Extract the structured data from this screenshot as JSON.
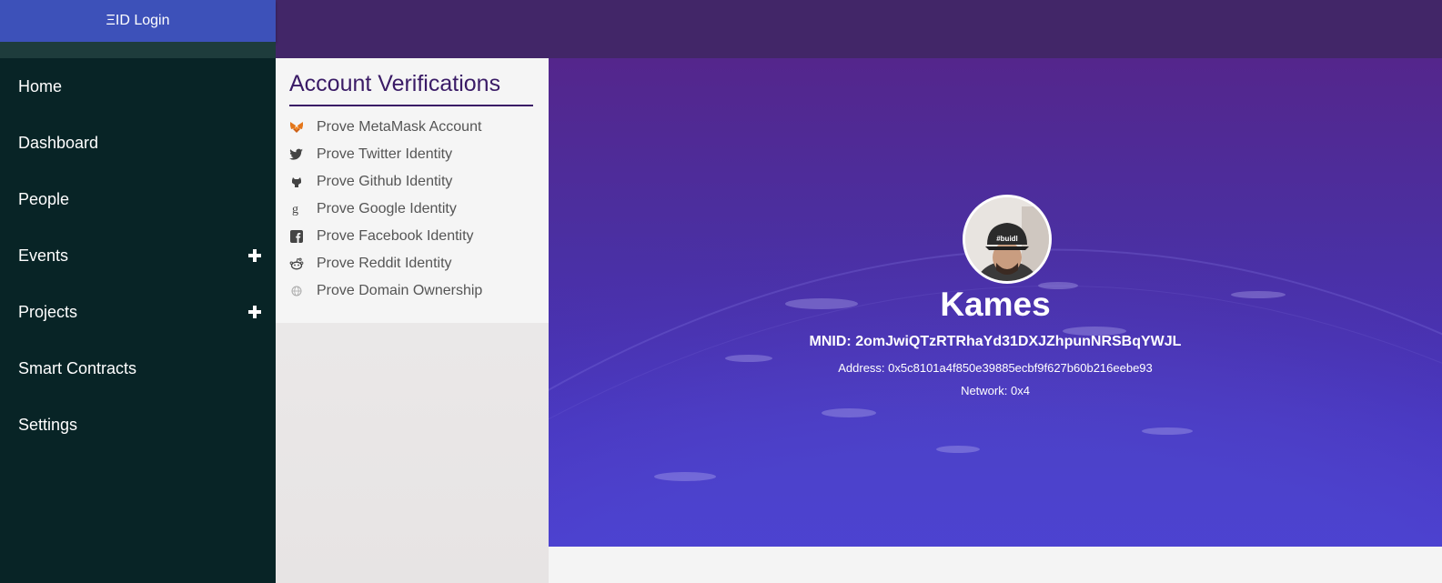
{
  "header": {
    "login_label": "ΞID Login"
  },
  "sidebar": {
    "items": [
      {
        "label": "Home",
        "expandable": false
      },
      {
        "label": "Dashboard",
        "expandable": false
      },
      {
        "label": "People",
        "expandable": false
      },
      {
        "label": "Events",
        "expandable": true
      },
      {
        "label": "Projects",
        "expandable": true
      },
      {
        "label": "Smart Contracts",
        "expandable": false
      },
      {
        "label": "Settings",
        "expandable": false
      }
    ]
  },
  "verifications": {
    "title": "Account Verifications",
    "items": [
      {
        "label": "Prove MetaMask Account",
        "icon": "metamask-icon"
      },
      {
        "label": "Prove Twitter Identity",
        "icon": "twitter-icon"
      },
      {
        "label": "Prove Github Identity",
        "icon": "github-icon"
      },
      {
        "label": "Prove Google Identity",
        "icon": "google-icon"
      },
      {
        "label": "Prove Facebook Identity",
        "icon": "facebook-icon"
      },
      {
        "label": "Prove Reddit Identity",
        "icon": "reddit-icon"
      },
      {
        "label": "Prove Domain Ownership",
        "icon": "globe-icon"
      }
    ]
  },
  "profile": {
    "name": "Kames",
    "mnid": "MNID: 2omJwiQTzRTRhaYd31DXJZhpunNRSBqYWJL",
    "address": "Address: 0x5c8101a4f850e39885ecbf9f627b60b216eebe93",
    "network": "Network: 0x4",
    "avatar_cap_text": "#buidl"
  },
  "colors": {
    "topbar": "#422668",
    "login_button": "#3d51b9",
    "sidebar": "#082426",
    "accent": "#3a1b66",
    "hero_top": "#54268c",
    "hero_bottom": "#4436cc"
  }
}
